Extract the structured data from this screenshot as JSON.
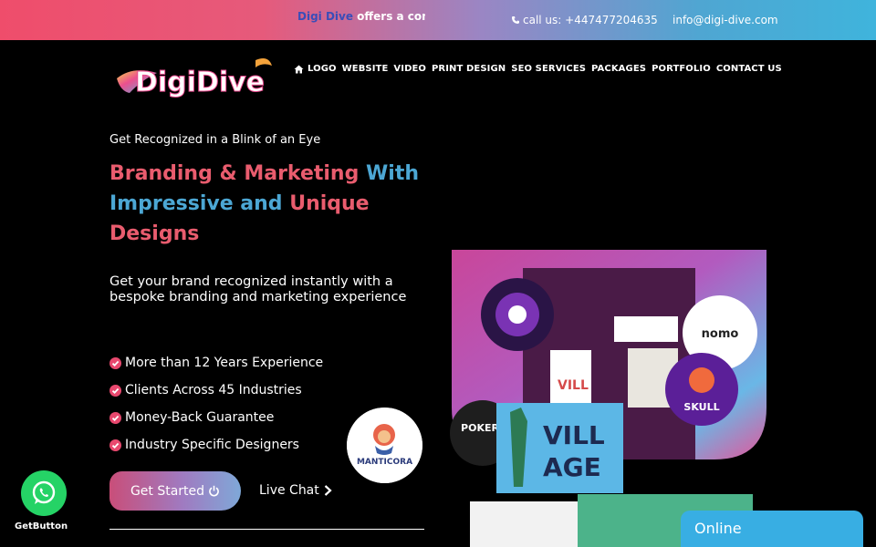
{
  "topbar": {
    "marquee_brand": "Digi Dive",
    "marquee_rest": " offers a com",
    "phone": "call us: +447477204635",
    "email": "info@digi-dive.com"
  },
  "logo": {
    "text": "DigiDive"
  },
  "nav": {
    "items": [
      {
        "label": "LOGO",
        "icon": "home-icon"
      },
      {
        "label": "WEBSITE"
      },
      {
        "label": "VIDEO"
      },
      {
        "label": "PRINT DESIGN"
      },
      {
        "label": "SEO SERVICES"
      },
      {
        "label": "PACKAGES"
      },
      {
        "label": "PORTFOLIO"
      },
      {
        "label": "CONTACT US"
      }
    ]
  },
  "hero": {
    "eyebrow": "Get Recognized in a Blink of an Eye",
    "headline_1": "Branding & Marketing",
    "headline_2": " With Impressive and",
    "headline_3": " Unique Designs",
    "subtitle": "Get your brand recognized instantly with a bespoke branding and marketing experience",
    "features": [
      "More than 12 Years Experience",
      "Clients Across 45 Industries",
      "Money-Back Guarantee",
      "Industry Specific Designers"
    ],
    "cta_label": "Get Started",
    "live_chat_label": "Live Chat",
    "badge_text": "MANTICORA"
  },
  "collage": {
    "logos": [
      "VILLAGE",
      "nomo",
      "SKULL",
      "POKER"
    ]
  },
  "whatsapp": {
    "label": "GetButton"
  },
  "chat_widget": {
    "label": "Online"
  },
  "colors": {
    "accent_red": "#e95c6e",
    "accent_blue": "#4ca7d4",
    "whatsapp_green": "#25d366",
    "widget_blue": "#38aee3"
  }
}
